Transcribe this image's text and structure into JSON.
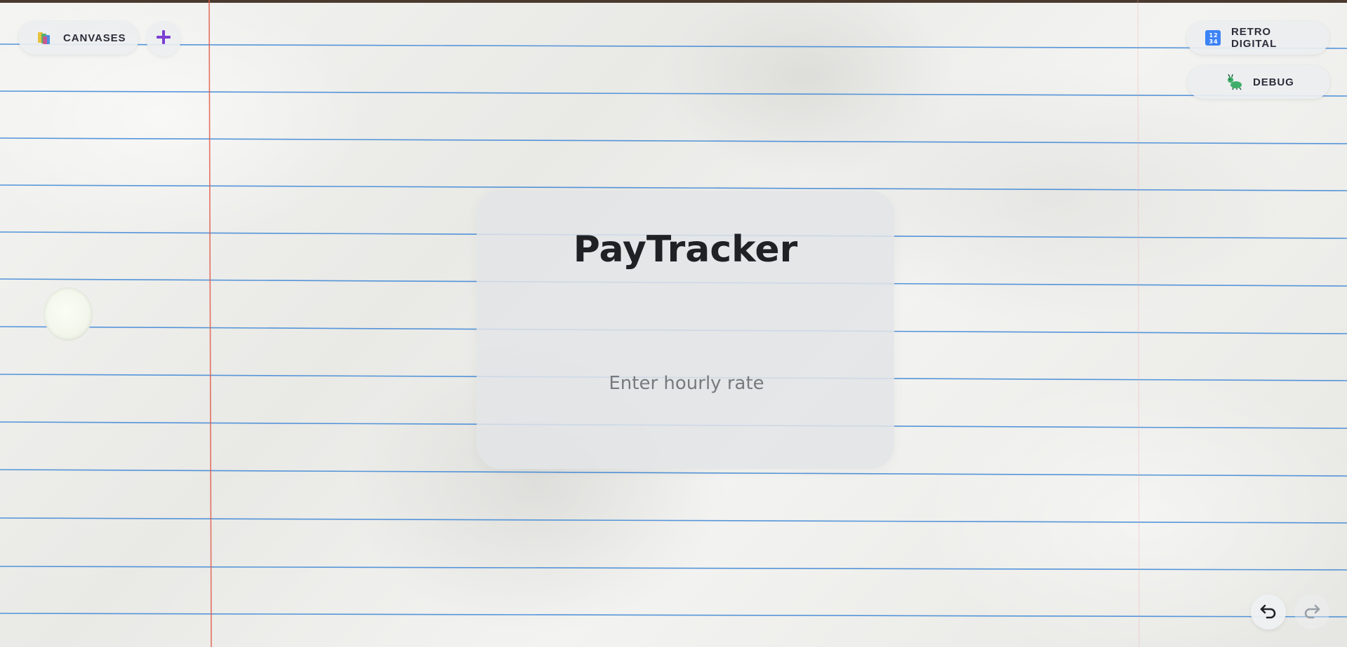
{
  "header": {
    "canvases_label": "CANVASES",
    "add_label": "+",
    "retro_label": "RETRO DIGITAL",
    "debug_label": "DEBUG"
  },
  "card": {
    "title": "PayTracker",
    "rate_placeholder": "Enter hourly rate",
    "rate_value": ""
  },
  "controls": {
    "undo_icon": "undo-arrow",
    "redo_icon": "redo-arrow",
    "redo_enabled": false
  },
  "icons": {
    "canvases": "books-icon",
    "retro": "input-numbers-icon",
    "debug": "bug-icon",
    "add": "plus-icon"
  },
  "colors": {
    "accent_purple": "#7b3fd1",
    "margin_line": "#e05a4a",
    "ruled_line": "#3a86d6"
  }
}
